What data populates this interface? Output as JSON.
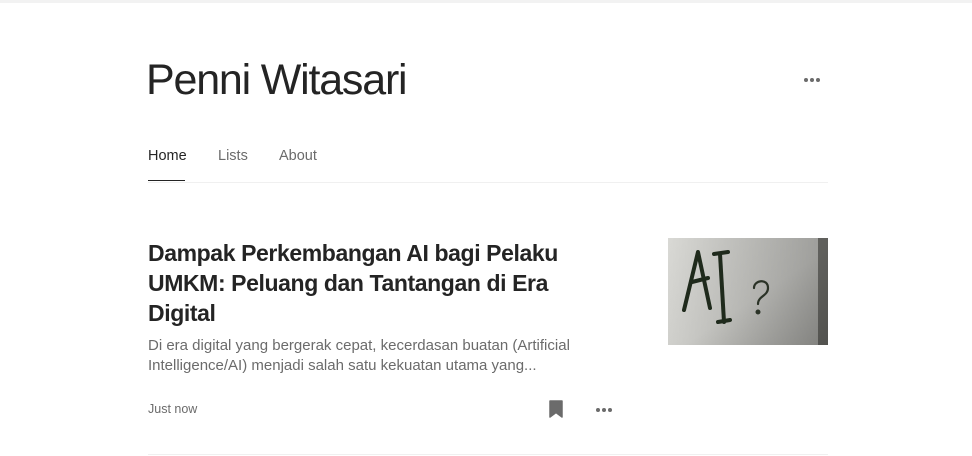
{
  "profile": {
    "name": "Penni Witasari",
    "more_icon": "more-horizontal-icon"
  },
  "tabs": [
    {
      "label": "Home",
      "active": true
    },
    {
      "label": "Lists",
      "active": false
    },
    {
      "label": "About",
      "active": false
    }
  ],
  "article": {
    "title": "Dampak Perkembangan AI bagi Pelaku UMKM: Peluang dan Tantangan di Era Digital",
    "excerpt": "Di era digital yang bergerak cepat, kecerdasan buatan (Artificial Intelligence/AI) menjadi salah satu kekuatan utama yang...",
    "date": "Just now",
    "thumbnail_text": "AI?",
    "bookmark_icon": "bookmark-icon",
    "more_icon": "more-horizontal-icon"
  },
  "colors": {
    "text_primary": "#242424",
    "text_secondary": "#6b6b6b",
    "divider": "#f0f0f0"
  }
}
